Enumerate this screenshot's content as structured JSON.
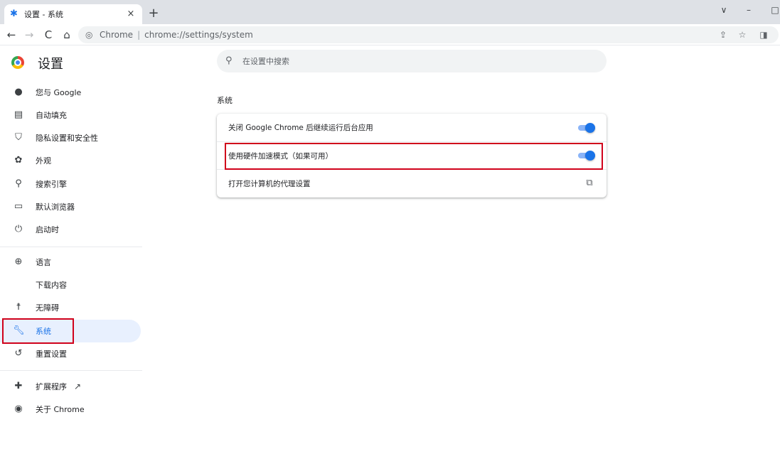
{
  "tab": {
    "title": "设置 - 系统",
    "favicon": "gear-icon",
    "close": "×"
  },
  "new_tab": "+",
  "window_controls": {
    "minimize": "–",
    "restore": "□",
    "dropdown": "∨"
  },
  "toolbar": {
    "back": "←",
    "forward": "→",
    "reload": "C",
    "home": "⌂",
    "omnibox_origin": "Chrome",
    "omnibox_separator": "|",
    "omnibox_url": "chrome://settings/system"
  },
  "header": {
    "title": "设置"
  },
  "search": {
    "placeholder": "在设置中搜索"
  },
  "sidebar": {
    "items": [
      {
        "label": "您与 Google",
        "icon": "person-icon"
      },
      {
        "label": "自动填充",
        "icon": "clipboard-icon"
      },
      {
        "label": "隐私设置和安全性",
        "icon": "shield-icon"
      },
      {
        "label": "外观",
        "icon": "palette-icon"
      },
      {
        "label": "搜索引擎",
        "icon": "search-icon"
      },
      {
        "label": "默认浏览器",
        "icon": "browser-icon"
      },
      {
        "label": "启动时",
        "icon": "power-icon"
      },
      {
        "label": "语言",
        "icon": "globe-icon"
      },
      {
        "label": "下载内容",
        "icon": "download-icon"
      },
      {
        "label": "无障碍",
        "icon": "accessibility-icon"
      },
      {
        "label": "系统",
        "icon": "wrench-icon",
        "active": true
      },
      {
        "label": "重置设置",
        "icon": "history-icon"
      },
      {
        "label": "扩展程序",
        "icon": "puzzle-icon"
      },
      {
        "label": "关于 Chrome",
        "icon": "chrome-icon"
      }
    ]
  },
  "main": {
    "section_title": "系统",
    "rows": [
      {
        "label": "关闭 Google Chrome 后继续运行后台应用",
        "toggle": true
      },
      {
        "label": "使用硬件加速模式（如果可用）",
        "toggle": true
      },
      {
        "label": "打开您计算机的代理设置",
        "action": "launch-icon"
      }
    ]
  },
  "colors": {
    "accent": "#1a73e8",
    "highlight": "#d0021b",
    "toggle_track": "#8ab4f8"
  }
}
